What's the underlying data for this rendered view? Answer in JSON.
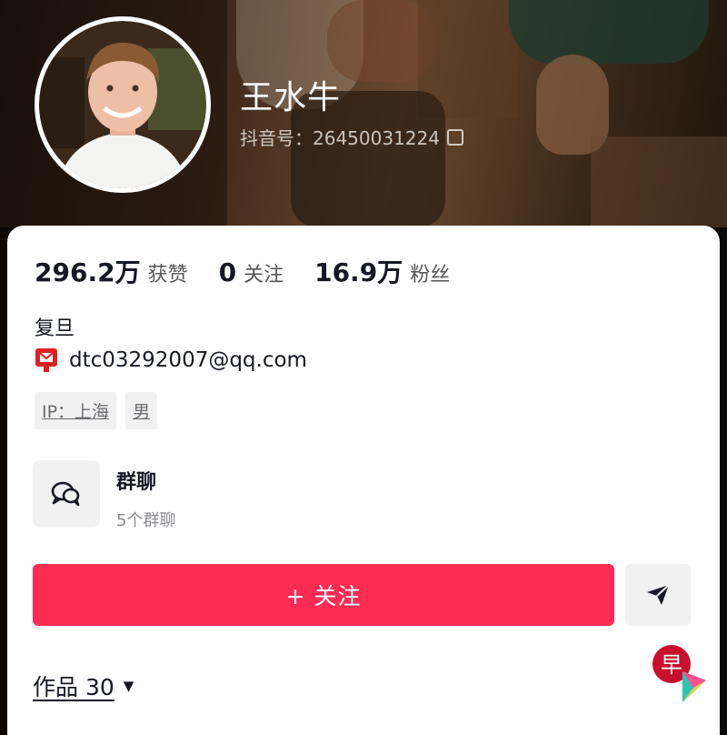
{
  "profile": {
    "name": "王水牛",
    "douyin_id": "抖音号：26450031224"
  },
  "stats": [
    {
      "value": "296.2万",
      "label": "获赞"
    },
    {
      "value": "0",
      "label": "关注"
    },
    {
      "value": "16.9万",
      "label": "粉丝"
    }
  ],
  "bio": {
    "school": "复旦",
    "email": "dtc03292007@qq.com"
  },
  "tags": [
    "IP：上海",
    "男"
  ],
  "group_chat": {
    "title": "群聊",
    "subtitle": "5个群聊"
  },
  "actions": {
    "follow_label": "+ 关注"
  },
  "tabs": {
    "works_label": "作品 30"
  },
  "watermark": {
    "char": "早"
  },
  "colors": {
    "accent": "#fe2c55",
    "text": "#161823",
    "muted": "#8a8b91",
    "chip_bg": "#f1f1f2"
  },
  "icons": {
    "copy": "copy-icon",
    "email": "mail-badge-icon",
    "group": "chat-bubbles-icon",
    "send": "send-icon",
    "caret": "caret-down-icon"
  }
}
